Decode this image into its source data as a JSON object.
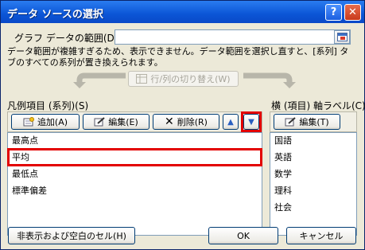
{
  "dialog": {
    "title": "データ ソースの選択"
  },
  "range": {
    "label": "グラフ データの範囲(D):",
    "value": ""
  },
  "message": "データ範囲が複雑すぎるため、表示できません。データ範囲を選択し直すと、[系列] タブのすべての系列が置き換えられます。",
  "switch_button": "行/列の切り替え(W)",
  "legend_panel": {
    "label": "凡例項目 (系列)(S)",
    "add": "追加(A)",
    "edit": "編集(E)",
    "delete": "削除(R)",
    "items": [
      "最高点",
      "平均",
      "最低点",
      "標準偏差"
    ],
    "selected_index": 1
  },
  "axis_panel": {
    "label": "横 (項目) 軸ラベル(C)",
    "edit": "編集(T)",
    "items": [
      "国語",
      "英語",
      "数学",
      "理科",
      "社会"
    ]
  },
  "footer": {
    "hidden_cells": "非表示および空白のセル(H)",
    "ok": "OK",
    "cancel": "キャンセル"
  },
  "colors": {
    "highlight": "#e30000",
    "titlebar": "#0b55d6"
  }
}
